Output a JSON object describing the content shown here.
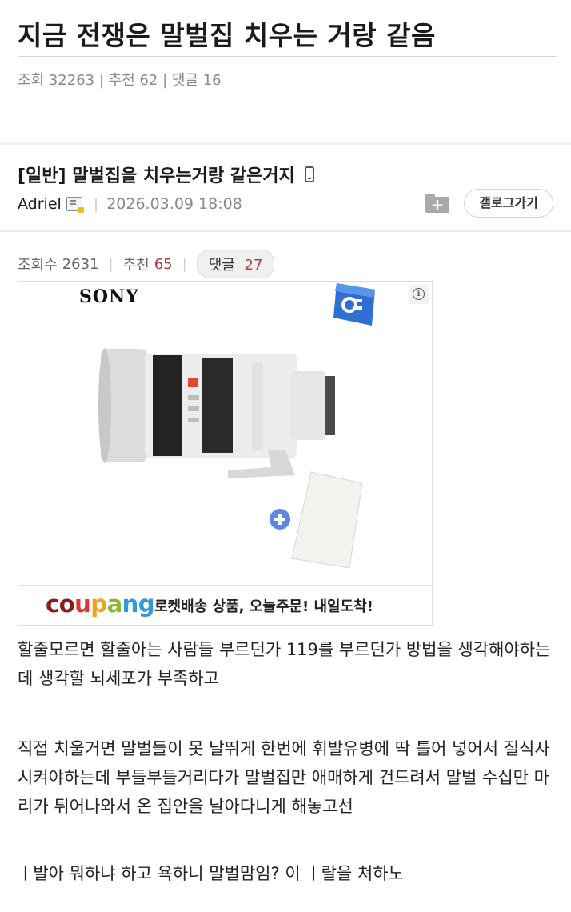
{
  "page_title": "지금 전쟁은 말벌집 치우는 거랑 같음",
  "top_stats": "조회 32263 | 추천 62 | 댓글 16",
  "post": {
    "category_title": "[일반] 말벌집을 치우는거랑 같은거지",
    "author": "Adriel",
    "datetime": "2026.03.09 18:08",
    "gallery_button": "갤로그가기",
    "views_label": "조회수",
    "views": "2631",
    "recommend_label": "추천",
    "recommend": "65",
    "comments_label": "댓글",
    "comments": "27"
  },
  "ad": {
    "brand": "SONY",
    "info_glyph": "i",
    "coupang_letters": [
      {
        "ch": "c",
        "color": "#8c1c1c"
      },
      {
        "ch": "o",
        "color": "#8c1c1c"
      },
      {
        "ch": "u",
        "color": "#d63a2a"
      },
      {
        "ch": "p",
        "color": "#f0a21a"
      },
      {
        "ch": "a",
        "color": "#8ab832"
      },
      {
        "ch": "n",
        "color": "#2f9bd6"
      },
      {
        "ch": "g",
        "color": "#2f9bd6"
      }
    ],
    "tagline": "로켓배송 상품, 오늘주문! 내일도착!"
  },
  "body": {
    "p1": "할줄모르면 할줄아는 사람들 부르던가 119를 부르던가 방법을 생각해야하는데 생각할 뇌세포가 부족하고",
    "p2": "직접 치울거면 말벌들이 못 날뛰게 한번에 휘발유병에 딱 틀어 넣어서 질식사 시켜야하는데 부들부들거리다가 말벌집만 애매하게 건드려서 말벌 수십만 마리가 튀어나와서 온 집안을 날아다니게 해놓고선",
    "p3": "ㅣ발아 뭐하냐 하고 욕하니 말벌맘임? 이 ㅣ랄을 쳐하노"
  },
  "colors": {
    "red_count": "#b33b3b",
    "phone_icon": "#4b4f8a"
  }
}
